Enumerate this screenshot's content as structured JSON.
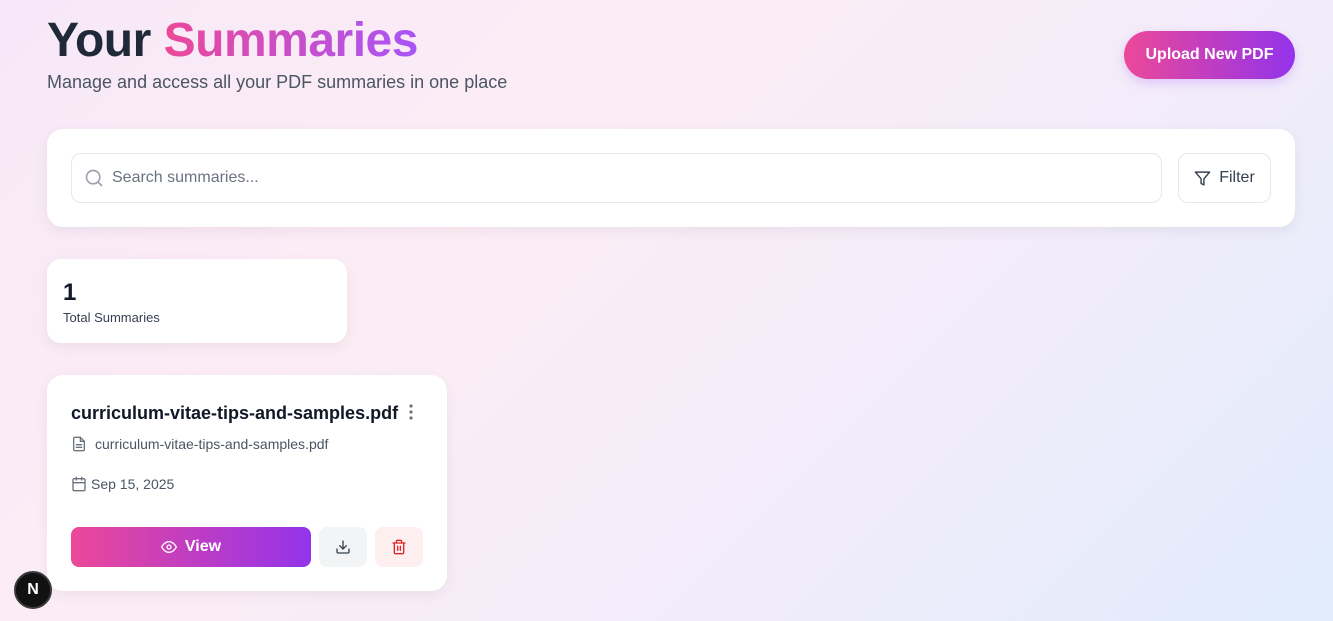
{
  "header": {
    "title_plain": "Your",
    "title_accent": "Summaries",
    "subtitle": "Manage and access all your PDF summaries in one place"
  },
  "upload_button": {
    "label": "Upload New PDF"
  },
  "search": {
    "placeholder": "Search summaries...",
    "value": "",
    "icon": "search-icon"
  },
  "filter_button": {
    "label": "Filter",
    "icon": "filter-icon"
  },
  "stats": {
    "total_count": "1",
    "total_label": "Total Summaries"
  },
  "summaries": [
    {
      "title": "curriculum-vitae-tips-and-samples.pdf",
      "file_name": "curriculum-vitae-tips-and-samples.pdf",
      "date": "Sep 15, 2025",
      "view_label": "View"
    }
  ],
  "dev_badge": {
    "letter": "N"
  },
  "colors": {
    "accent_pink": "#ec4899",
    "accent_purple": "#9333ea",
    "delete_red": "#dc2626"
  }
}
